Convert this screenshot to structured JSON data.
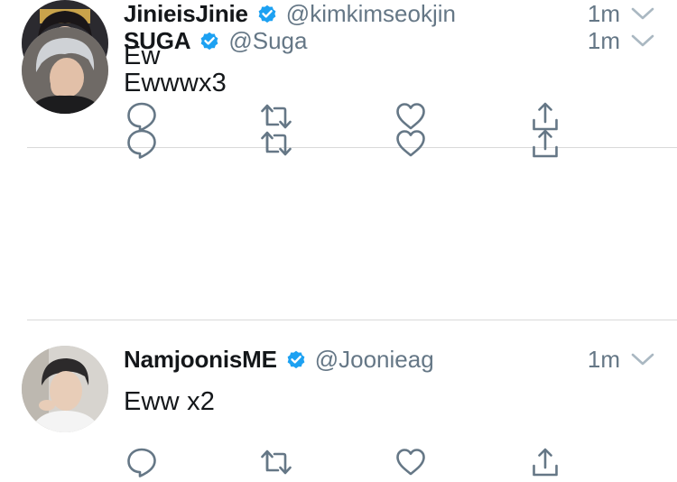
{
  "colors": {
    "text_primary": "#14171a",
    "text_secondary": "#657786",
    "verified_blue": "#1da1f2",
    "icon_gray": "#657786",
    "divider": "#d9d9d9"
  },
  "tweets": [
    {
      "display_name": "JinieisJinie",
      "handle": "@kimkimseokjin",
      "time": "1m",
      "text": "Ew",
      "verified": true,
      "avatar_icon": "avatar-photo"
    },
    {
      "display_name": "NamjoonisME",
      "handle": "@Joonieag",
      "time": "1m",
      "text": "Eww x2",
      "verified": true,
      "avatar_icon": "avatar-photo"
    },
    {
      "display_name": "SUGA",
      "handle": "@Suga",
      "time": "1m",
      "text": "Ewwwx3",
      "verified": true,
      "avatar_icon": "avatar-photo"
    }
  ],
  "action_icons": [
    "reply-icon",
    "retweet-icon",
    "like-icon",
    "share-icon"
  ],
  "menu_icon": "chevron-down-icon"
}
